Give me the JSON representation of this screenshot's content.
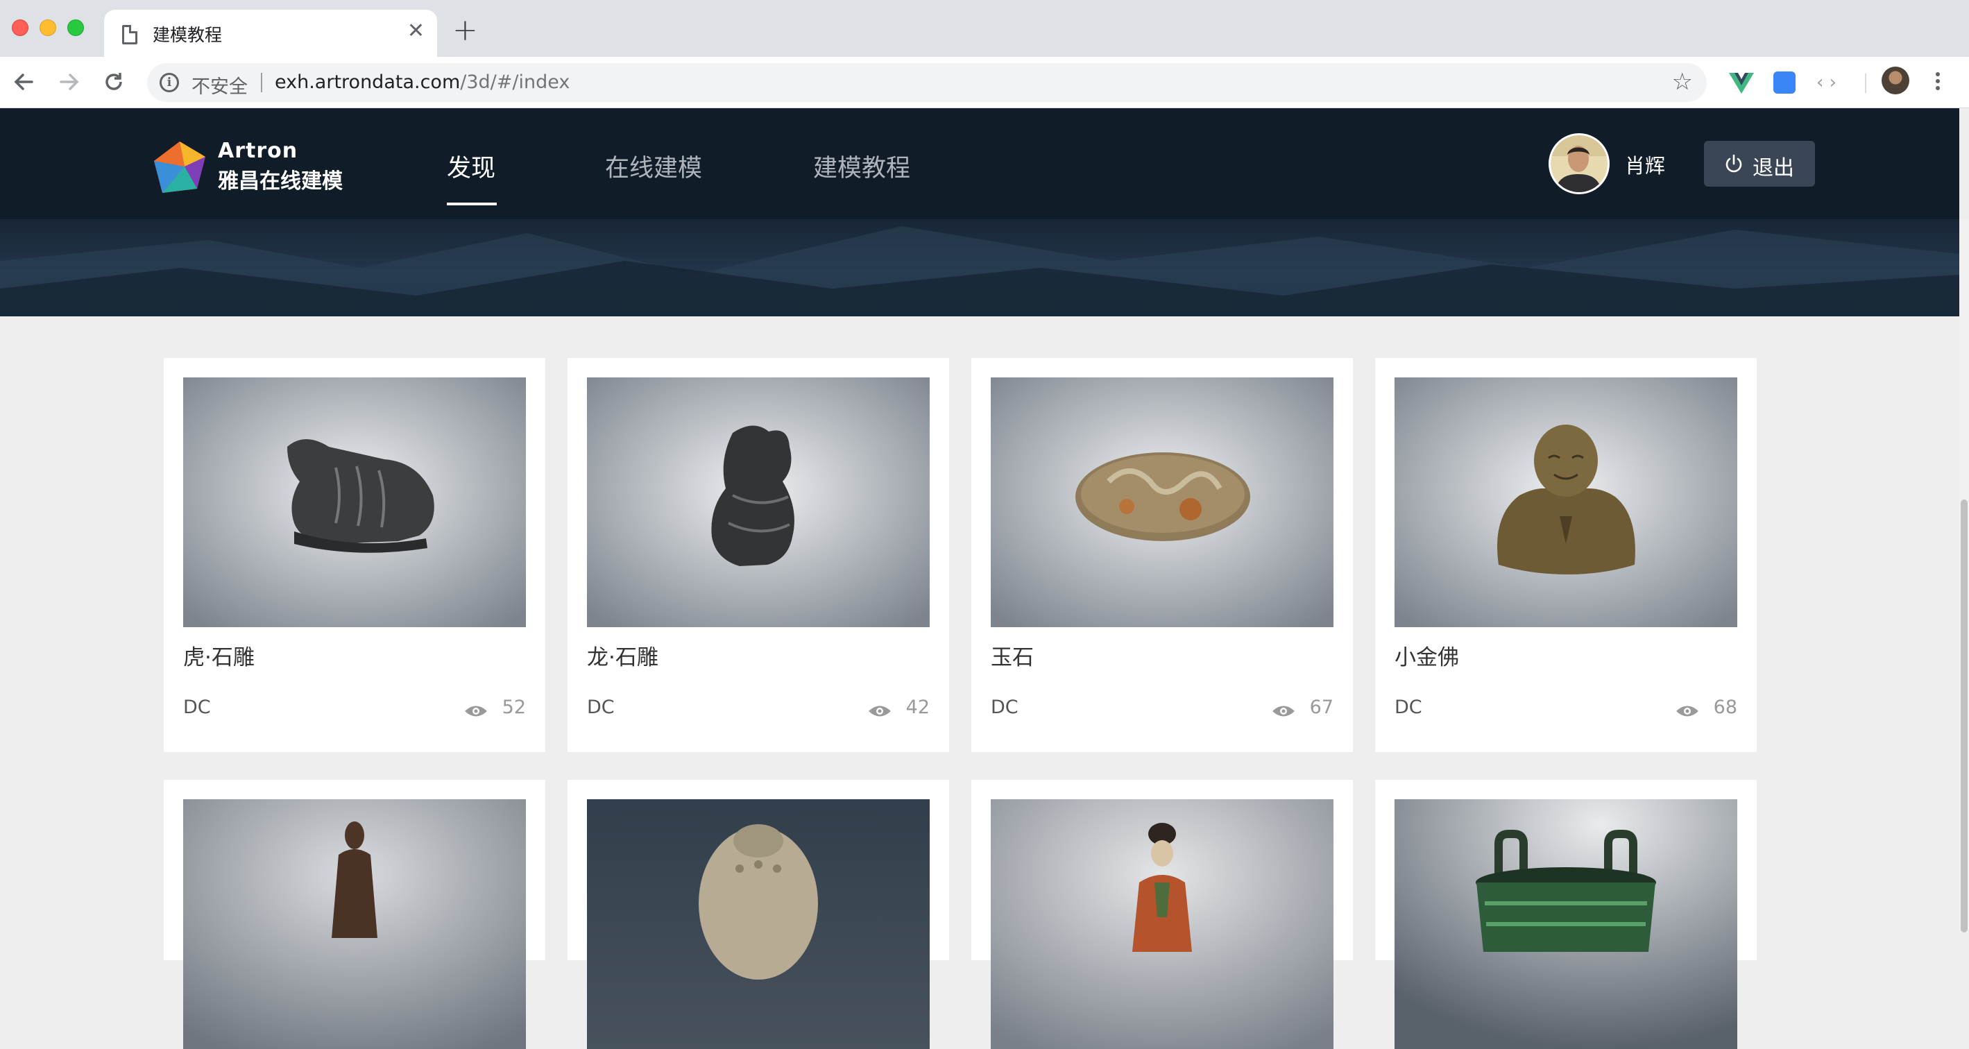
{
  "browser": {
    "tab_title": "建模教程",
    "security_label": "不安全",
    "url_host": "exh.artrondata.com",
    "url_path": "/3d/#/index"
  },
  "site": {
    "logo_en": "Artron",
    "logo_cn": "雅昌在线建模",
    "nav": [
      {
        "label": "发现",
        "active": true
      },
      {
        "label": "在线建模",
        "active": false
      },
      {
        "label": "建模教程",
        "active": false
      }
    ],
    "user_name": "肖辉",
    "logout_label": "退出",
    "colors": {
      "header_bg": "#111c29",
      "logout_bg": "#3a4655",
      "page_bg": "#eeeeee"
    }
  },
  "cards": [
    {
      "title": "虎·石雕",
      "author": "DC",
      "views": "52",
      "thumb": "tiger-stone-carving"
    },
    {
      "title": "龙·石雕",
      "author": "DC",
      "views": "42",
      "thumb": "dragon-stone-carving"
    },
    {
      "title": "玉石",
      "author": "DC",
      "views": "67",
      "thumb": "jade-stone"
    },
    {
      "title": "小金佛",
      "author": "DC",
      "views": "68",
      "thumb": "small-golden-buddha"
    },
    {
      "thumb": "guanyin-statue"
    },
    {
      "thumb": "buddha-head"
    },
    {
      "thumb": "tang-lady-figurine"
    },
    {
      "thumb": "bronze-ding-vessel"
    }
  ]
}
